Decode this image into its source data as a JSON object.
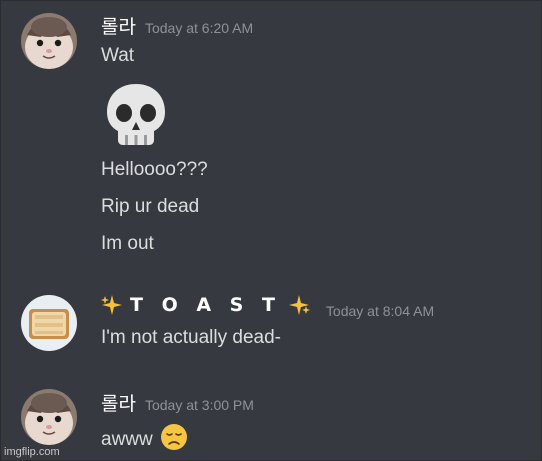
{
  "messages": [
    {
      "username": "롤라",
      "timestamp": "Today at 6:20 AM",
      "avatar": "cat-avatar-icon",
      "lines": [
        "Wat",
        "Hellоооо???",
        "Rip ur dead",
        "Im out"
      ],
      "emoji": "skull-emoji"
    },
    {
      "username": "T O A S T",
      "timestamp": "Today at 8:04 AM",
      "avatar": "toast-avatar-icon",
      "lines": [
        "I'm not actually dead-"
      ],
      "decorations": "sparkles-icon"
    },
    {
      "username": "롤라",
      "timestamp": "Today at 3:00 PM",
      "avatar": "cat-avatar-icon",
      "lines": [
        "awww"
      ],
      "emoji": "disappointed-face-emoji"
    }
  ],
  "watermark": "imgflip.com",
  "colors": {
    "background": "#36393f",
    "text": "#dcddde",
    "username": "#ffffff",
    "timestamp": "#8e9297"
  }
}
